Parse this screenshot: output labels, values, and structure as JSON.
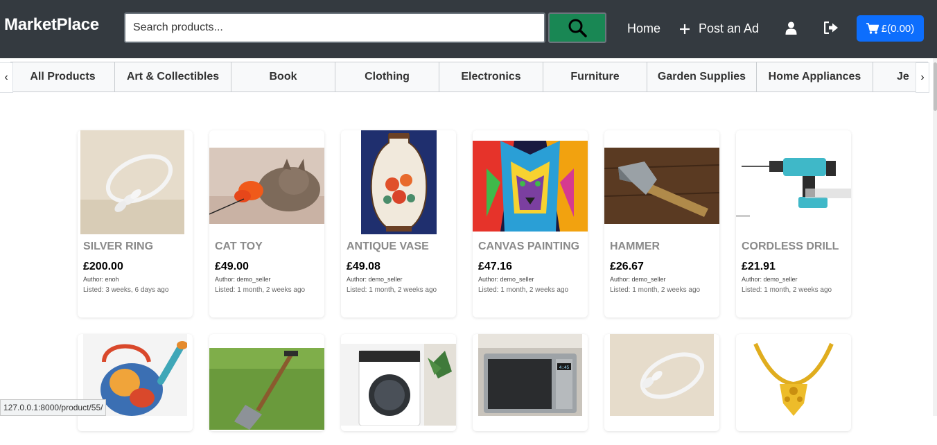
{
  "navbar": {
    "brand": "MarketPlace",
    "search_placeholder": "Search products...",
    "home_label": "Home",
    "post_ad_label": "Post an Ad",
    "cart_label": "£(0.00)"
  },
  "categories": [
    "All Products",
    "Art & Collectibles",
    "Book",
    "Clothing",
    "Electronics",
    "Furniture",
    "Garden Supplies",
    "Home Appliances",
    "Je"
  ],
  "products": [
    {
      "name": "SILVER RING",
      "price": "£200.00",
      "author": "Author: enoh",
      "listed": "Listed: 3 weeks, 6 days ago"
    },
    {
      "name": "CAT TOY",
      "price": "£49.00",
      "author": "Author: demo_seller",
      "listed": "Listed: 1 month, 2 weeks ago"
    },
    {
      "name": "ANTIQUE VASE",
      "price": "£49.08",
      "author": "Author: demo_seller",
      "listed": "Listed: 1 month, 2 weeks ago"
    },
    {
      "name": "CANVAS PAINTING",
      "price": "£47.16",
      "author": "Author: demo_seller",
      "listed": "Listed: 1 month, 2 weeks ago"
    },
    {
      "name": "HAMMER",
      "price": "£26.67",
      "author": "Author: demo_seller",
      "listed": "Listed: 1 month, 2 weeks ago"
    },
    {
      "name": "CORDLESS DRILL",
      "price": "£21.91",
      "author": "Author: demo_seller",
      "listed": "Listed: 1 month, 2 weeks ago"
    }
  ],
  "second_row_images": [
    "watering-can-image",
    "garden-spade-image",
    "washing-machine-image",
    "microwave-image",
    "silver-ring-image",
    "gold-necklace-image"
  ],
  "status_bar": {
    "url": "127.0.0.1:8000/product/55/"
  },
  "colors": {
    "navbar": "#343a40",
    "search_button": "#198754",
    "cart_button": "#0d6efd",
    "category_bg": "#f8f9fa"
  }
}
